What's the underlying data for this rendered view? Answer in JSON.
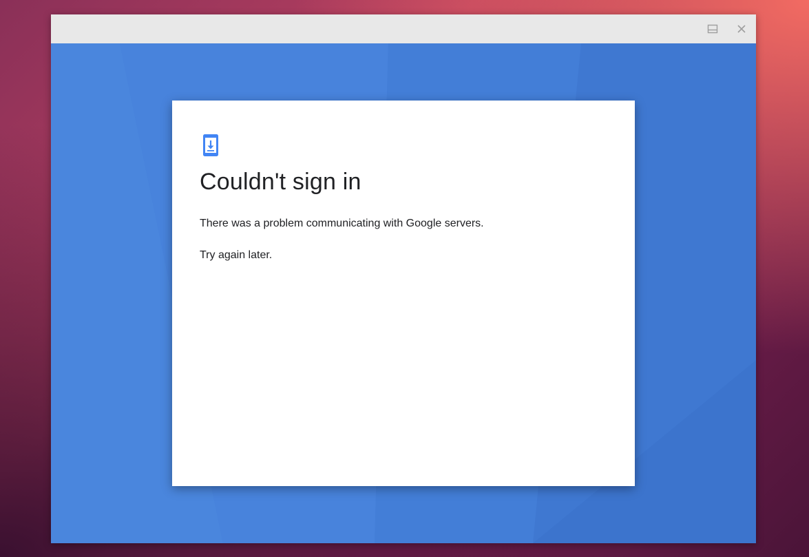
{
  "window": {
    "controls": {
      "maximize_icon": "maximize-icon",
      "close_icon": "close-icon"
    }
  },
  "dialog": {
    "icon": "phone-download-icon",
    "title": "Couldn't sign in",
    "message": "There was a problem communicating with Google servers.",
    "hint": "Try again later."
  },
  "colors": {
    "accent": "#4285f4",
    "background_blue": "#447fd8",
    "titlebar": "#e8e8e8",
    "text": "#202124"
  }
}
